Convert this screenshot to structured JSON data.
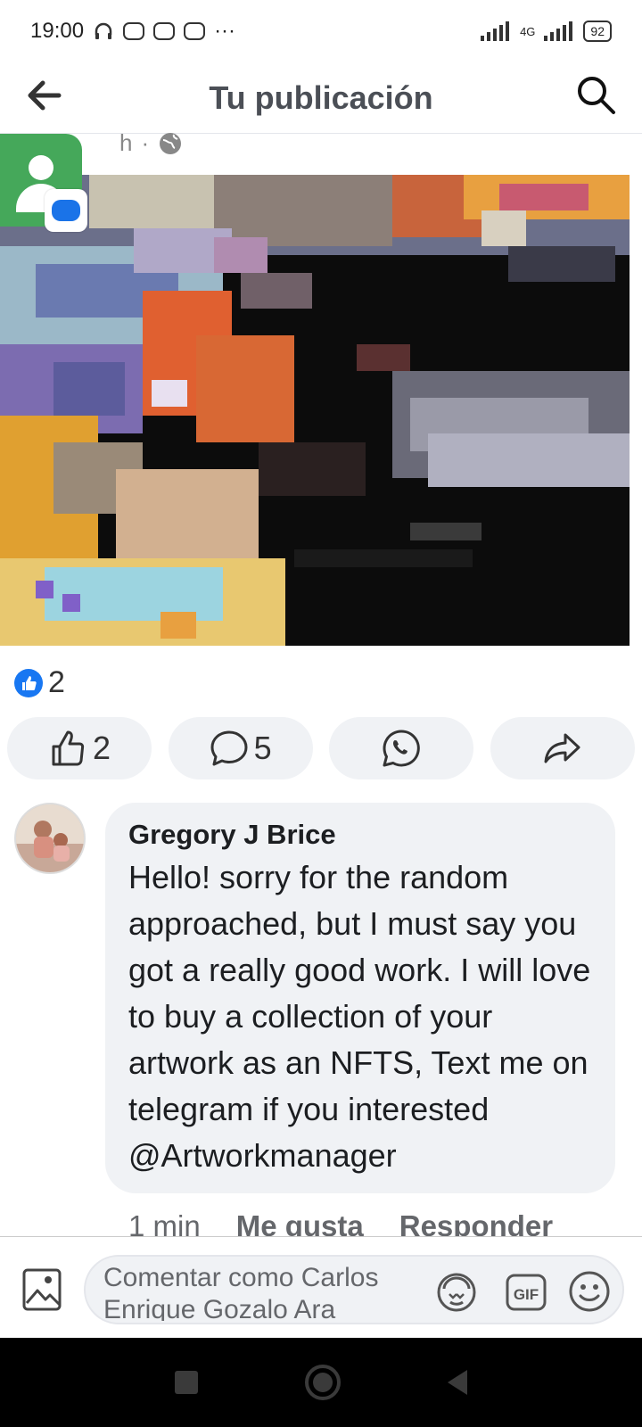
{
  "status_bar": {
    "time": "19:00",
    "more": "···",
    "network": "4G",
    "battery": "92"
  },
  "header": {
    "title": "Tu publicación"
  },
  "post": {
    "time": "h",
    "separator": "·",
    "reaction_count": "2"
  },
  "actions": {
    "like_count": "2",
    "comment_count": "5"
  },
  "comment": {
    "author": "Gregory J Brice",
    "text": "Hello! sorry for the random approached, but I must say you got a really good work. I will love to buy a collection of your artwork as an NFTS, Text me on telegram if you interested @Artworkmanager",
    "time": "1 min",
    "like_label": "Me gusta",
    "reply_label": "Responder"
  },
  "composer": {
    "placeholder": "Comentar como Carlos Enrique Gozalo Ara"
  },
  "colors": {
    "facebook_blue": "#1877f2",
    "bubble_gray": "#f0f2f5",
    "avatar_green": "#45a85a"
  }
}
